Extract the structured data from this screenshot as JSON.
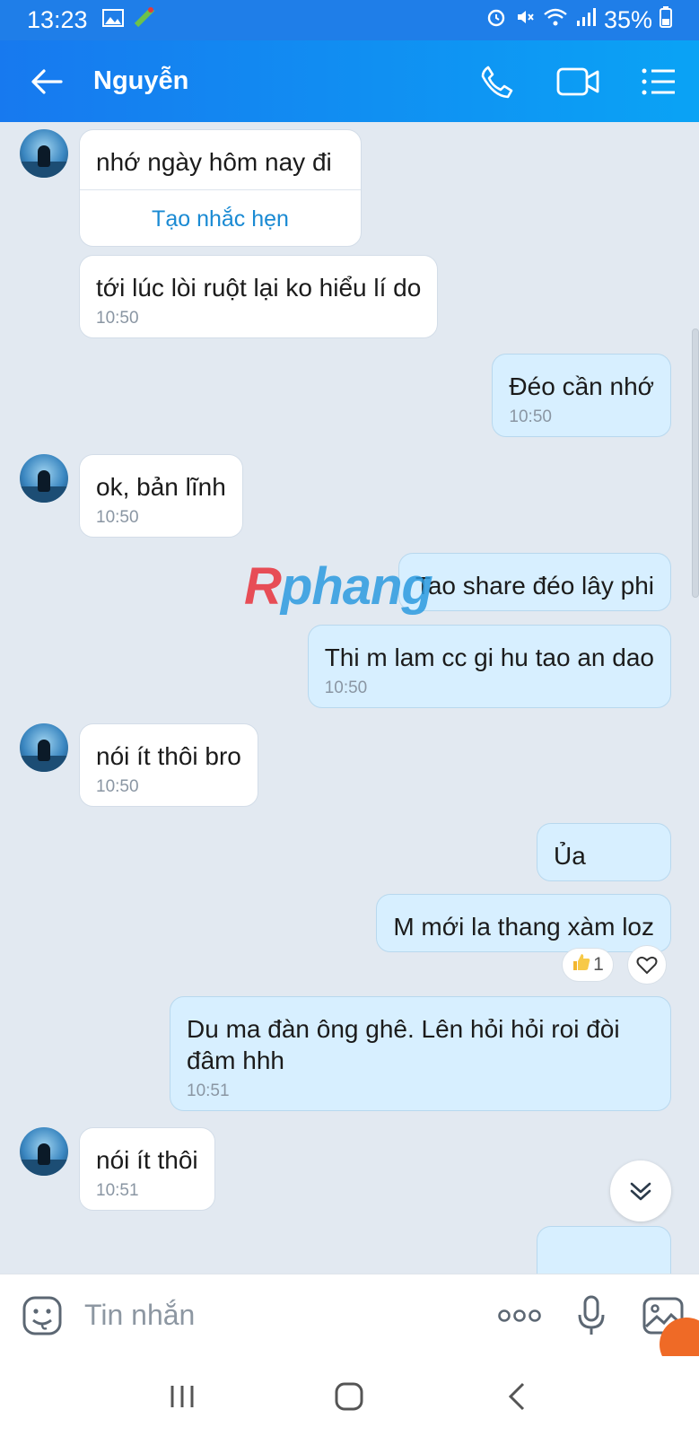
{
  "status_bar": {
    "time": "13:23",
    "battery": "35%"
  },
  "header": {
    "contact_name": "Nguyễn"
  },
  "messages": [
    {
      "direction": "incoming",
      "text": "nhớ ngày hôm nay đi",
      "action_label": "Tạo nhắc hẹn"
    },
    {
      "direction": "incoming",
      "text": "tới lúc lòi ruột lại ko hiểu lí do",
      "time": "10:50"
    },
    {
      "direction": "outgoing",
      "text": "Đéo cần nhớ",
      "time": "10:50"
    },
    {
      "direction": "incoming",
      "text": "ok, bản lĩnh",
      "time": "10:50"
    },
    {
      "direction": "outgoing",
      "text": "Tao share đéo lây phi"
    },
    {
      "direction": "outgoing",
      "text": "Thi m lam cc gi hu tao an dao",
      "time": "10:50"
    },
    {
      "direction": "incoming",
      "text": "nói ít thôi bro",
      "time": "10:50"
    },
    {
      "direction": "outgoing",
      "text": "Ủa"
    },
    {
      "direction": "outgoing",
      "text": "M mới la thang xàm loz",
      "reaction_count": "1"
    },
    {
      "direction": "outgoing",
      "text": "Du ma đàn ông ghê. Lên hỏi hỏi roi đòi đâm hhh",
      "time": "10:51"
    },
    {
      "direction": "incoming",
      "text": "nói ít thôi",
      "time": "10:51"
    }
  ],
  "watermark": {
    "first": "R",
    "rest": "phang"
  },
  "composer": {
    "placeholder": "Tin nhắn"
  },
  "colors": {
    "header_start": "#1779ef",
    "header_end": "#0aa3f5",
    "outgoing_bubble": "#d7efff",
    "incoming_bubble": "#ffffff",
    "chat_background": "#e2e9f1",
    "link": "#1a8ad3"
  },
  "icons": {
    "back": "arrow-left-icon",
    "call": "phone-icon",
    "video": "video-camera-icon",
    "menu": "list-menu-icon",
    "emoji": "emoji-icon",
    "more": "more-dots-icon",
    "mic": "microphone-icon",
    "gallery": "image-icon",
    "scroll": "double-chevron-down-icon"
  }
}
